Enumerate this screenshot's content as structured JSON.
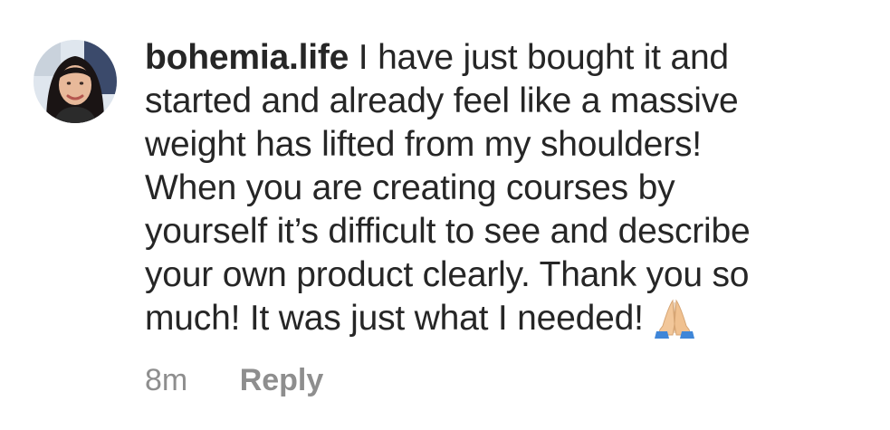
{
  "comment": {
    "username": "bohemia.life",
    "text_lines": [
      "I have just bought it and",
      "started and already feel like a massive",
      "weight has lifted from my shoulders!",
      "When you are creating courses by",
      "yourself it’s difficult to see and describe",
      "your own product clearly. Thank you so",
      "much! It was just what I needed!"
    ],
    "emoji_icon": "folded-hands-icon",
    "timestamp": "8m",
    "reply_label": "Reply"
  },
  "colors": {
    "text": "#262626",
    "muted": "#8e8e8e"
  }
}
